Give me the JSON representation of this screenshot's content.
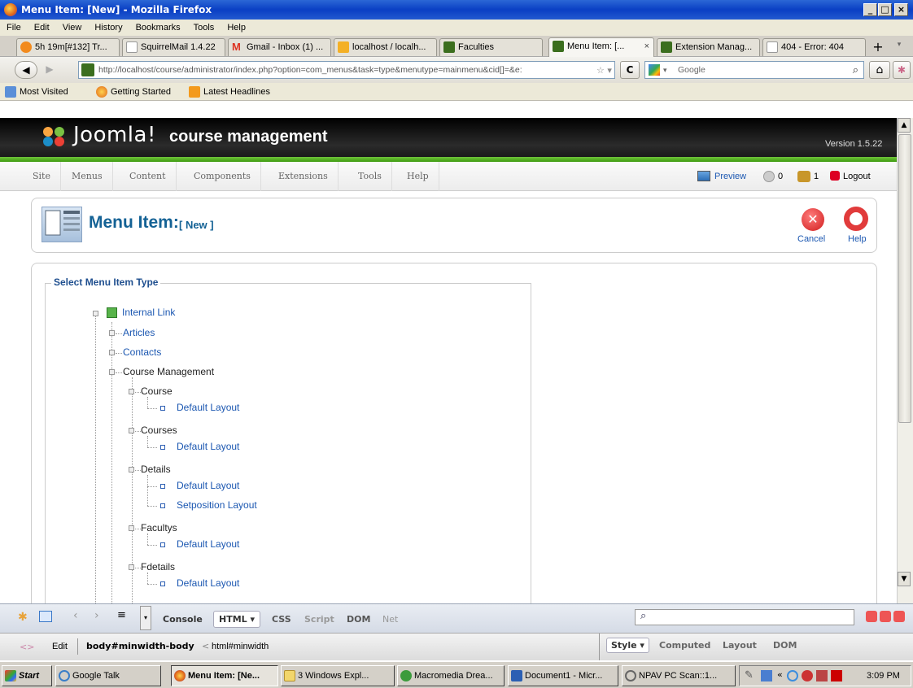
{
  "window": {
    "title": "Menu Item: [New] - Mozilla Firefox"
  },
  "menubar": {
    "items": [
      "File",
      "Edit",
      "View",
      "History",
      "Bookmarks",
      "Tools",
      "Help"
    ]
  },
  "tabs": [
    {
      "label": "5h 19m[#132] Tr..."
    },
    {
      "label": "SquirrelMail 1.4.22"
    },
    {
      "label": "Gmail - Inbox (1) ..."
    },
    {
      "label": "localhost / localh..."
    },
    {
      "label": "Faculties"
    },
    {
      "label": "Menu Item: [..."
    },
    {
      "label": "Extension Manag..."
    },
    {
      "label": "404 - Error: 404"
    }
  ],
  "tab_close_glyph": "×",
  "new_tab_glyph": "+",
  "nav": {
    "url": "http://localhost/course/administrator/index.php?option=com_menus&task=type&menutype=mainmenu&cid[]=&e:",
    "search_placeholder": "Google"
  },
  "bookmarks": [
    "Most Visited",
    "Getting Started",
    "Latest Headlines"
  ],
  "joomla": {
    "logo_text": "Joomla!",
    "site_name": "course management",
    "version": "Version 1.5.22",
    "menu": [
      "Site",
      "Menus",
      "Content",
      "Components",
      "Extensions",
      "Tools",
      "Help"
    ],
    "status": {
      "preview": "Preview",
      "messages": "0",
      "users": "1",
      "logout": "Logout"
    },
    "page_title": "Menu Item:",
    "page_subtitle": "[ New ]",
    "toolbar": {
      "cancel": "Cancel",
      "help": "Help"
    },
    "fieldset_legend": "Select Menu Item Type",
    "tree": {
      "root": "Internal Link",
      "level1": [
        "Articles",
        "Contacts",
        "Course Management"
      ],
      "components": [
        {
          "name": "Course",
          "layouts": [
            "Default Layout"
          ]
        },
        {
          "name": "Courses",
          "layouts": [
            "Default Layout"
          ]
        },
        {
          "name": "Details",
          "layouts": [
            "Default Layout",
            "Setposition Layout"
          ]
        },
        {
          "name": "Facultys",
          "layouts": [
            "Default Layout"
          ]
        },
        {
          "name": "Fdetails",
          "layouts": [
            "Default Layout"
          ]
        }
      ]
    }
  },
  "firebug": {
    "tabs": [
      "Console",
      "HTML ▾",
      "CSS",
      "Script",
      "DOM",
      "Net"
    ],
    "edit": "Edit",
    "breadcrumb_main": "body#minwidth-body",
    "breadcrumb_sep": "<",
    "breadcrumb_parent": "html#minwidth",
    "side_tabs": [
      "Style ▾",
      "Computed",
      "Layout",
      "DOM"
    ]
  },
  "taskbar": {
    "start": "Start",
    "items": [
      "Google Talk",
      "Menu Item: [Ne...",
      "3 Windows Expl...",
      "Macromedia Drea...",
      "Document1 - Micr...",
      "NPAV PC Scan::1..."
    ],
    "clock": "3:09 PM"
  }
}
